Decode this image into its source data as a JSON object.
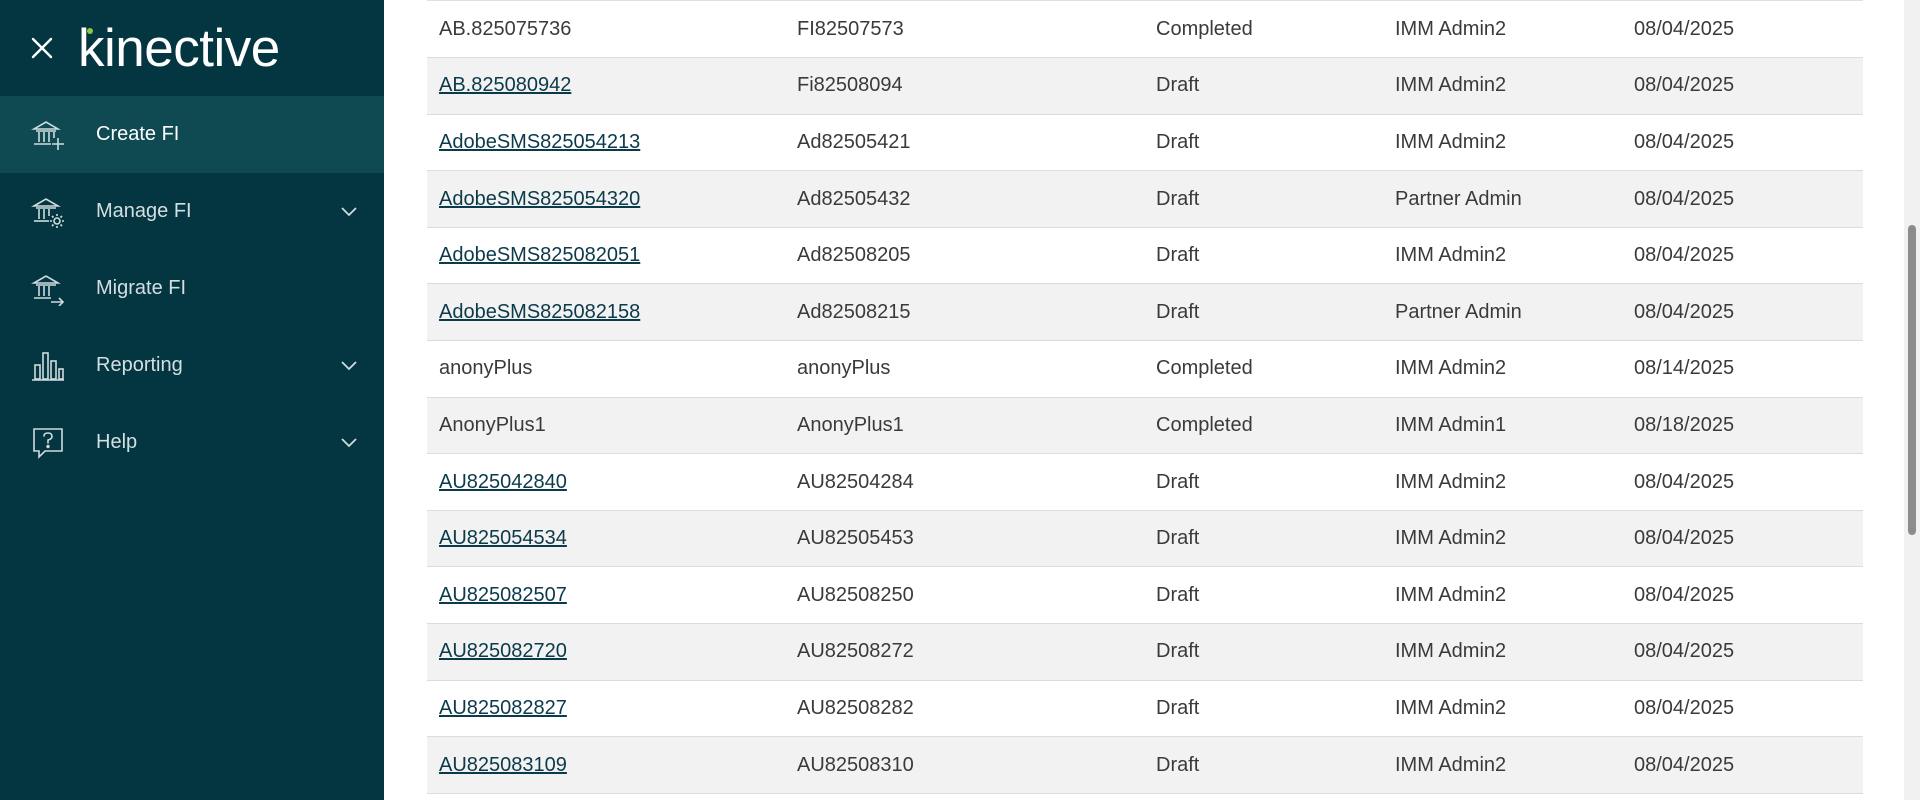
{
  "brand": {
    "logo_text": "kinective",
    "close_icon": "close-icon"
  },
  "sidebar": {
    "items": [
      {
        "label": "Create FI",
        "icon": "bank-plus-icon",
        "active": true,
        "expandable": false
      },
      {
        "label": "Manage FI",
        "icon": "bank-gear-icon",
        "active": false,
        "expandable": true
      },
      {
        "label": "Migrate FI",
        "icon": "bank-arrow-icon",
        "active": false,
        "expandable": false
      },
      {
        "label": "Reporting",
        "icon": "bar-chart-icon",
        "active": false,
        "expandable": true
      },
      {
        "label": "Help",
        "icon": "help-bubble-icon",
        "active": false,
        "expandable": true
      }
    ]
  },
  "table": {
    "rows": [
      {
        "name": "AB.825075736",
        "code": "FI82507573",
        "status": "Completed",
        "owner": "IMM Admin2",
        "date": "08/04/2025",
        "link": false
      },
      {
        "name": "AB.825080942",
        "code": "Fi82508094",
        "status": "Draft",
        "owner": "IMM Admin2",
        "date": "08/04/2025",
        "link": true
      },
      {
        "name": "AdobeSMS825054213",
        "code": "Ad82505421",
        "status": "Draft",
        "owner": "IMM Admin2",
        "date": "08/04/2025",
        "link": true
      },
      {
        "name": "AdobeSMS825054320",
        "code": "Ad82505432",
        "status": "Draft",
        "owner": "Partner Admin",
        "date": "08/04/2025",
        "link": true
      },
      {
        "name": "AdobeSMS825082051",
        "code": "Ad82508205",
        "status": "Draft",
        "owner": "IMM Admin2",
        "date": "08/04/2025",
        "link": true
      },
      {
        "name": "AdobeSMS825082158",
        "code": "Ad82508215",
        "status": "Draft",
        "owner": "Partner Admin",
        "date": "08/04/2025",
        "link": true
      },
      {
        "name": "anonyPlus",
        "code": "anonyPlus",
        "status": "Completed",
        "owner": "IMM Admin2",
        "date": "08/14/2025",
        "link": false
      },
      {
        "name": "AnonyPlus1",
        "code": "AnonyPlus1",
        "status": "Completed",
        "owner": "IMM Admin1",
        "date": "08/18/2025",
        "link": false
      },
      {
        "name": "AU825042840",
        "code": "AU82504284",
        "status": "Draft",
        "owner": "IMM Admin2",
        "date": "08/04/2025",
        "link": true
      },
      {
        "name": "AU825054534",
        "code": "AU82505453",
        "status": "Draft",
        "owner": "IMM Admin2",
        "date": "08/04/2025",
        "link": true
      },
      {
        "name": "AU825082507",
        "code": "AU82508250",
        "status": "Draft",
        "owner": "IMM Admin2",
        "date": "08/04/2025",
        "link": true
      },
      {
        "name": "AU825082720",
        "code": "AU82508272",
        "status": "Draft",
        "owner": "IMM Admin2",
        "date": "08/04/2025",
        "link": true
      },
      {
        "name": "AU825082827",
        "code": "AU82508282",
        "status": "Draft",
        "owner": "IMM Admin2",
        "date": "08/04/2025",
        "link": true
      },
      {
        "name": "AU825083109",
        "code": "AU82508310",
        "status": "Draft",
        "owner": "IMM Admin2",
        "date": "08/04/2025",
        "link": true
      }
    ]
  },
  "colors": {
    "sidebar_bg": "#033641",
    "sidebar_active_bg": "#0f4a53",
    "link": "#0b3a4a",
    "row_alt": "#f2f2f2"
  }
}
